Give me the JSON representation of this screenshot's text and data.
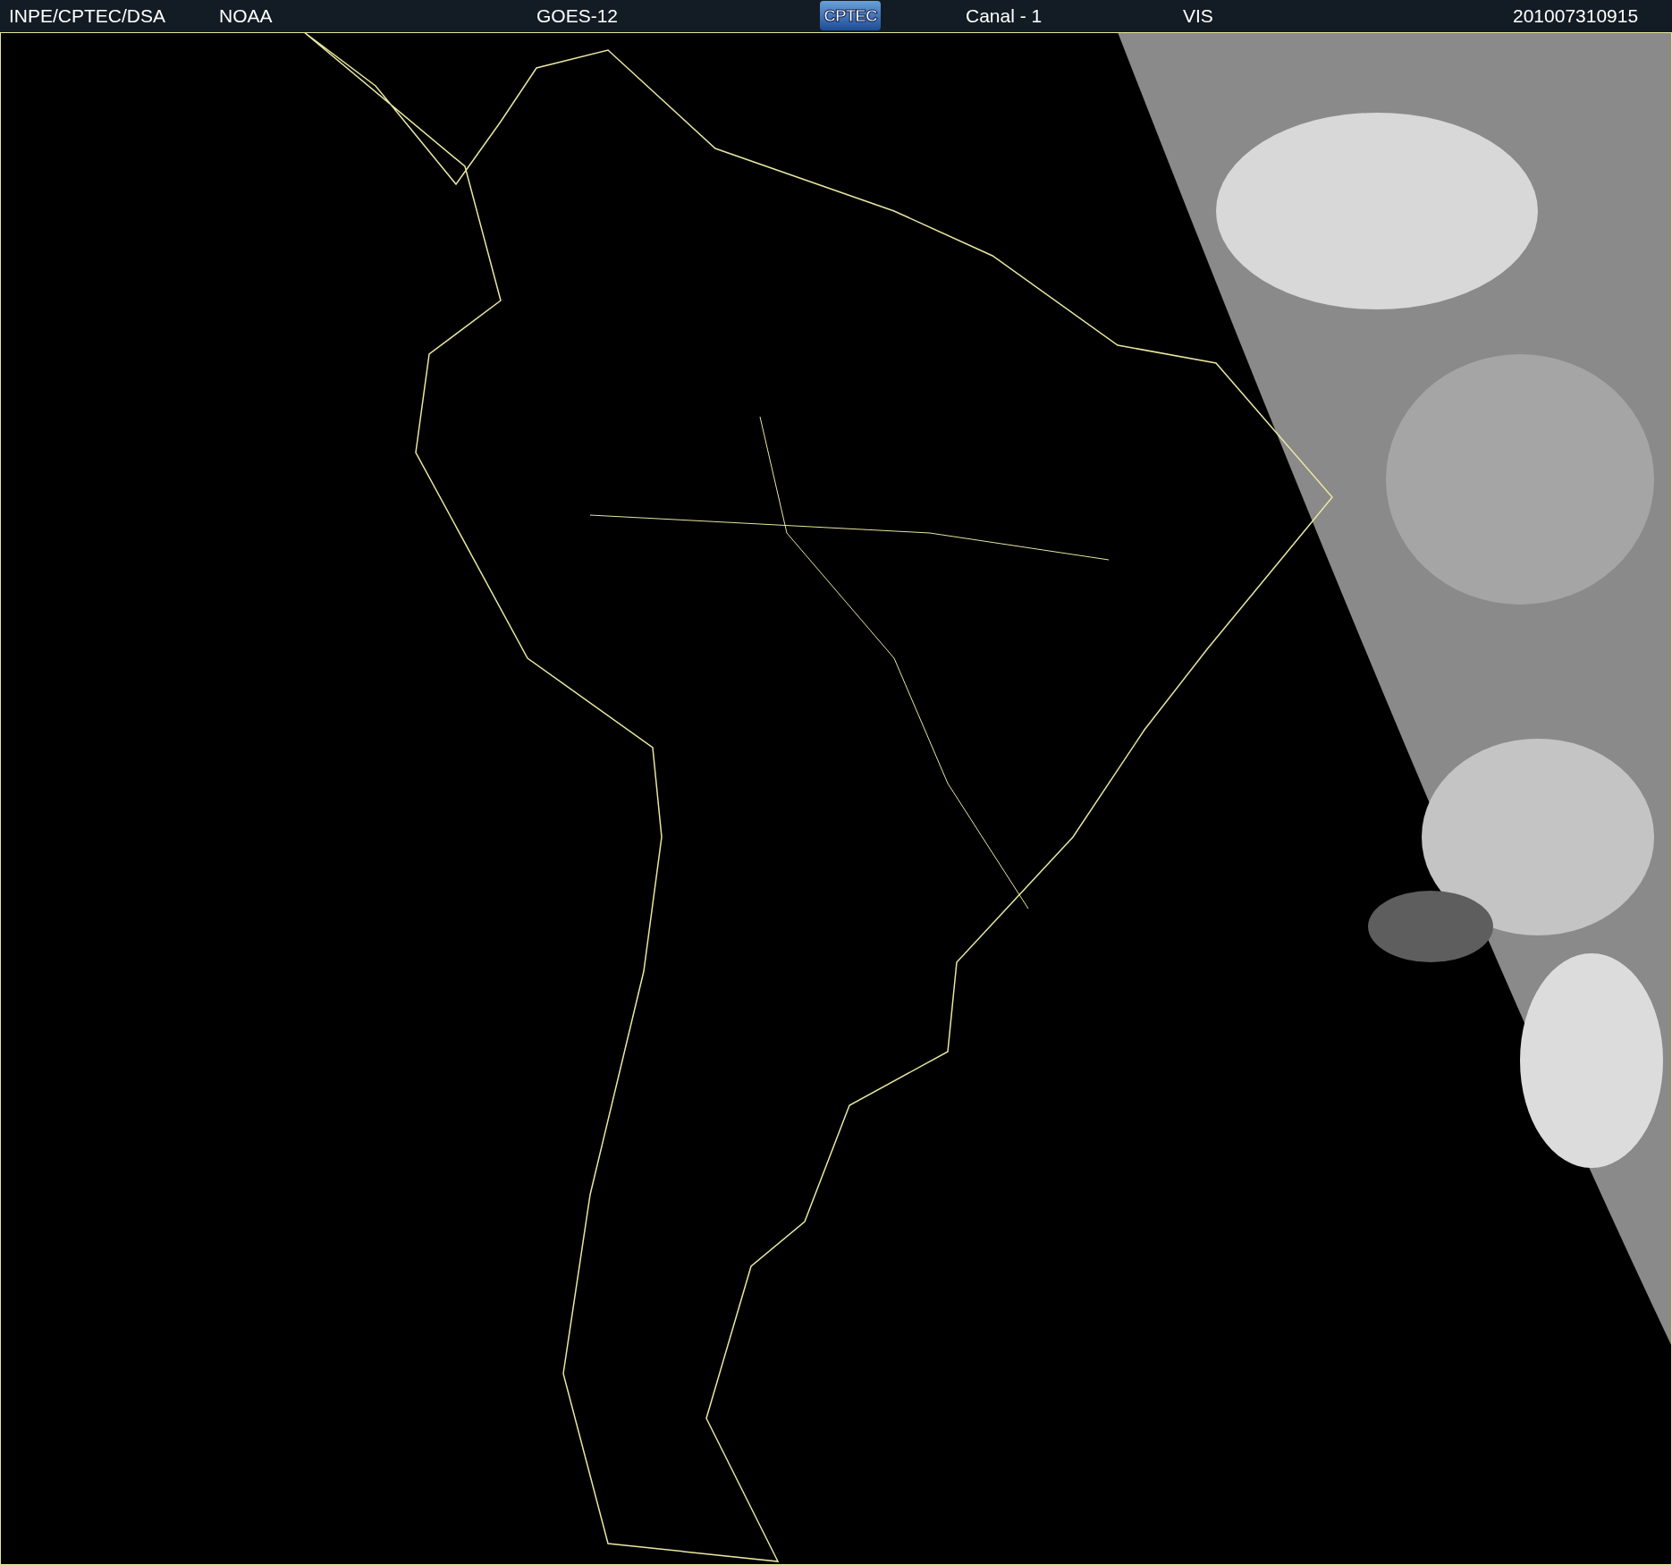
{
  "header": {
    "items": [
      {
        "kind": "text",
        "text": "INPE/CPTEC/DSA"
      },
      {
        "kind": "text",
        "text": "NOAA"
      },
      {
        "kind": "text",
        "text": "GOES-12"
      },
      {
        "kind": "logo",
        "text": "CPTEC"
      },
      {
        "kind": "text",
        "text": "Canal - 1"
      },
      {
        "kind": "text",
        "text": "VIS"
      },
      {
        "kind": "text",
        "text": "201007310915"
      }
    ]
  }
}
